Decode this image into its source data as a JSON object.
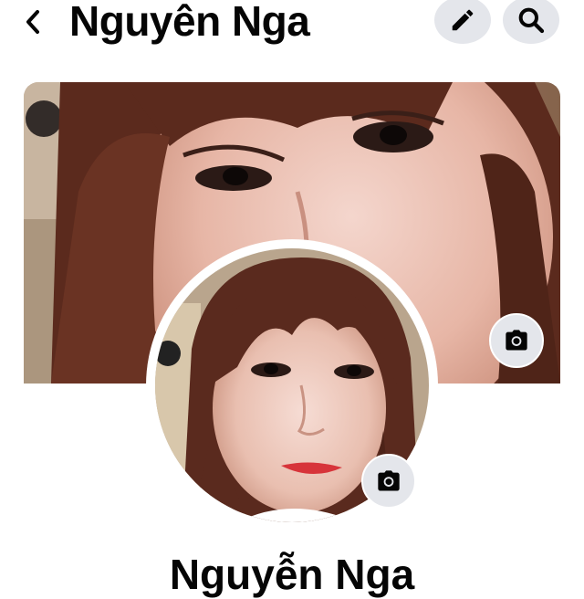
{
  "header": {
    "title": "Nguyên Nga",
    "back_icon": "chevron-left-icon",
    "edit_icon": "pencil-icon",
    "search_icon": "search-icon"
  },
  "cover": {
    "camera_icon": "camera-icon"
  },
  "avatar": {
    "camera_icon": "camera-icon"
  },
  "profile": {
    "name": "Nguyễn Nga"
  },
  "colors": {
    "button_bg": "#e4e6eb",
    "text": "#050505",
    "background": "#ffffff"
  }
}
